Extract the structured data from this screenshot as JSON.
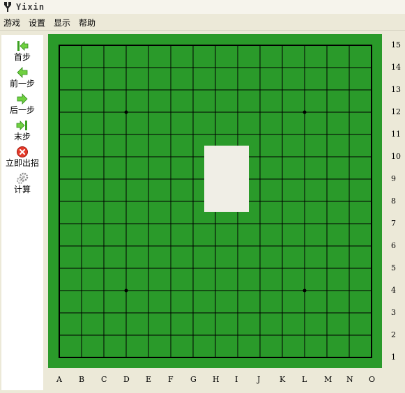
{
  "window": {
    "title": "Yixin"
  },
  "menu": [
    "游戏",
    "设置",
    "显示",
    "帮助"
  ],
  "toolbar": [
    {
      "label": "首步",
      "icon": "first-move-icon"
    },
    {
      "label": "前一步",
      "icon": "previous-move-icon"
    },
    {
      "label": "后一步",
      "icon": "next-move-icon"
    },
    {
      "label": "末步",
      "icon": "last-move-icon"
    },
    {
      "label": "立即出招",
      "icon": "stop-think-icon"
    },
    {
      "label": "计算",
      "icon": "gears-icon"
    }
  ],
  "board": {
    "size": 15,
    "files": [
      "A",
      "B",
      "C",
      "D",
      "E",
      "F",
      "G",
      "H",
      "I",
      "J",
      "K",
      "L",
      "M",
      "N",
      "O"
    ],
    "ranks": [
      "15",
      "14",
      "13",
      "12",
      "11",
      "10",
      "9",
      "8",
      "7",
      "6",
      "5",
      "4",
      "3",
      "2",
      "1"
    ],
    "star_points": [
      "D12",
      "L12",
      "D4",
      "L4"
    ],
    "colors": {
      "board": "#2a9a2a",
      "lines": "#000000",
      "frame": "#000000"
    }
  }
}
